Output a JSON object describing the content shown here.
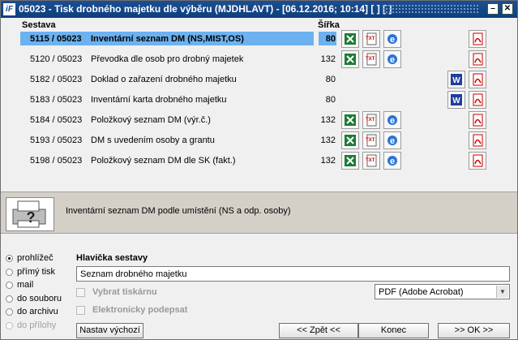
{
  "titlebar": {
    "title": "05023 - Tisk drobného majetku dle výběru (MJDHLAVT) - [06.12.2016; 10:14]  [ ]  [ ]",
    "logo": "iF",
    "btn_min": "–",
    "btn_close": "✕"
  },
  "headers": {
    "sestava": "Sestava",
    "sirka": "Šířka"
  },
  "rows": [
    {
      "code": "5115 / 05023",
      "name": "Inventární seznam DM (NS,MIST,OS)",
      "width": "80"
    },
    {
      "code": "5120 / 05023",
      "name": "Převodka dle osob pro drobný majetek",
      "width": "132"
    },
    {
      "code": "5182 / 05023",
      "name": "Doklad o zařazení drobného majetku",
      "width": "80"
    },
    {
      "code": "5183 / 05023",
      "name": "Inventární karta drobného majetku",
      "width": "80"
    },
    {
      "code": "5184 / 05023",
      "name": "Položkový seznam DM (výr.č.)",
      "width": "132"
    },
    {
      "code": "5193 / 05023",
      "name": "DM s uvedením osoby a grantu",
      "width": "132"
    },
    {
      "code": "5198 / 05023",
      "name": "Položkový seznam DM dle SK (fakt.)",
      "width": "132"
    }
  ],
  "icons": {
    "excel": "excel-icon",
    "txt": "txt-icon",
    "ie": "browser-icon",
    "word": "word-icon",
    "pdf": "pdf-icon"
  },
  "description": "Inventární seznam DM podle umístění (NS a odp. osoby)",
  "output": {
    "options": [
      "prohlížeč",
      "přímý tisk",
      "mail",
      "do souboru",
      "do archivu",
      "do přílohy"
    ],
    "selected": "prohlížeč"
  },
  "header_section": {
    "label": "Hlavička sestavy",
    "value": "Seznam drobného majetku",
    "select_printer": "Vybrat tiskárnu",
    "e_signature": "Elektronicky podepsat",
    "printer": "PDF (Adobe Acrobat)"
  },
  "buttons": {
    "defaults": "Nastav výchozí",
    "back": "<< Zpět <<",
    "end": "Konec",
    "ok": ">> OK >>"
  }
}
